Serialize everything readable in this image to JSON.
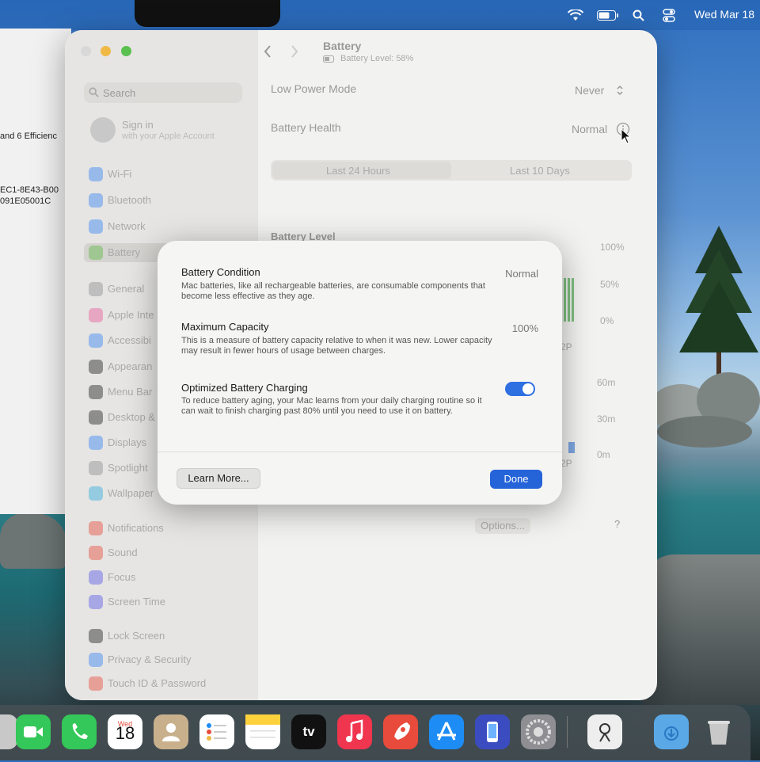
{
  "menubar": {
    "datetime": "Wed Mar 18"
  },
  "background_window": {
    "lines": [
      "and 6 Efficienc",
      "EC1-8E43-B00",
      "091E05001C"
    ]
  },
  "sidebar": {
    "search_placeholder": "Search",
    "sign_in": {
      "title": "Sign in",
      "subtitle": "with your Apple Account"
    },
    "items": [
      {
        "label": "Wi-Fi",
        "color": "#3a84f5"
      },
      {
        "label": "Bluetooth",
        "color": "#3a84f5"
      },
      {
        "label": "Network",
        "color": "#3a84f5"
      },
      {
        "label": "Battery",
        "color": "#5fb845"
      },
      {
        "label": "General",
        "color": "#8e8e93"
      },
      {
        "label": "Apple Inte",
        "color": "#e85a9a"
      },
      {
        "label": "Accessibi",
        "color": "#3a84f5"
      },
      {
        "label": "Appearan",
        "color": "#222222"
      },
      {
        "label": "Menu Bar",
        "color": "#222222"
      },
      {
        "label": "Desktop &",
        "color": "#222222"
      },
      {
        "label": "Displays",
        "color": "#3a84f5"
      },
      {
        "label": "Spotlight",
        "color": "#8e8e93"
      },
      {
        "label": "Wallpaper",
        "color": "#34aadc"
      },
      {
        "label": "Notifications",
        "color": "#e84b3c"
      },
      {
        "label": "Sound",
        "color": "#e84b3c"
      },
      {
        "label": "Focus",
        "color": "#5e5ce6"
      },
      {
        "label": "Screen Time",
        "color": "#5e5ce6"
      },
      {
        "label": "Lock Screen",
        "color": "#222222"
      },
      {
        "label": "Privacy & Security",
        "color": "#3a84f5"
      },
      {
        "label": "Touch ID & Password",
        "color": "#e84b3c"
      }
    ]
  },
  "header": {
    "title": "Battery",
    "subtitle": "Battery Level: 58%"
  },
  "content": {
    "low_power_mode": {
      "label": "Low Power Mode",
      "value": "Never"
    },
    "battery_health": {
      "label": "Battery Health",
      "value": "Normal"
    },
    "tabs": [
      "Last 24 Hours",
      "Last 10 Days"
    ],
    "battery_level_title": "Battery Level",
    "level_axis": [
      "100%",
      "50%",
      "0%"
    ],
    "time_axis": [
      "60m",
      "30m",
      "0m"
    ],
    "hour_label_1": "2P",
    "hour_label_2": "2P",
    "options_label": "Options...",
    "help_label": "?"
  },
  "dialog": {
    "condition": {
      "title": "Battery Condition",
      "value": "Normal",
      "desc": "Mac batteries, like all rechargeable batteries, are consumable components that become less effective as they age."
    },
    "capacity": {
      "title": "Maximum Capacity",
      "value": "100%",
      "desc": "This is a measure of battery capacity relative to when it was new. Lower capacity may result in fewer hours of usage between charges."
    },
    "optimized": {
      "title": "Optimized Battery Charging",
      "enabled": true,
      "desc": "To reduce battery aging, your Mac learns from your daily charging routine so it can wait to finish charging past 80% until you need to use it on battery."
    },
    "learn_more": "Learn More...",
    "done": "Done"
  },
  "dock": {
    "calendar": {
      "month": "Wed",
      "day": "18"
    },
    "apps": [
      {
        "name": "facetime-icon",
        "color": "#34c759"
      },
      {
        "name": "phone-icon",
        "color": "#34c759"
      },
      {
        "name": "calendar-icon",
        "color": "#ffffff"
      },
      {
        "name": "contacts-icon",
        "color": "#c9b08c"
      },
      {
        "name": "reminders-icon",
        "color": "#ffffff"
      },
      {
        "name": "notes-icon",
        "color": "#ffd23d"
      },
      {
        "name": "apple-tv-icon",
        "color": "#111111"
      },
      {
        "name": "music-icon",
        "color": "#f0354f"
      },
      {
        "name": "launchpad-icon",
        "color": "#e84b3c"
      },
      {
        "name": "app-store-icon",
        "color": "#1d8cf5"
      },
      {
        "name": "simulator-icon",
        "color": "#3b4cc0"
      },
      {
        "name": "system-settings-icon",
        "color": "#8e8e93"
      },
      {
        "name": "preview-icon",
        "color": "#eeeeee"
      },
      {
        "name": "downloads-folder-icon",
        "color": "#5aa9e6"
      },
      {
        "name": "trash-icon",
        "color": "#b8b8b8"
      }
    ],
    "tv_label": "tv"
  }
}
